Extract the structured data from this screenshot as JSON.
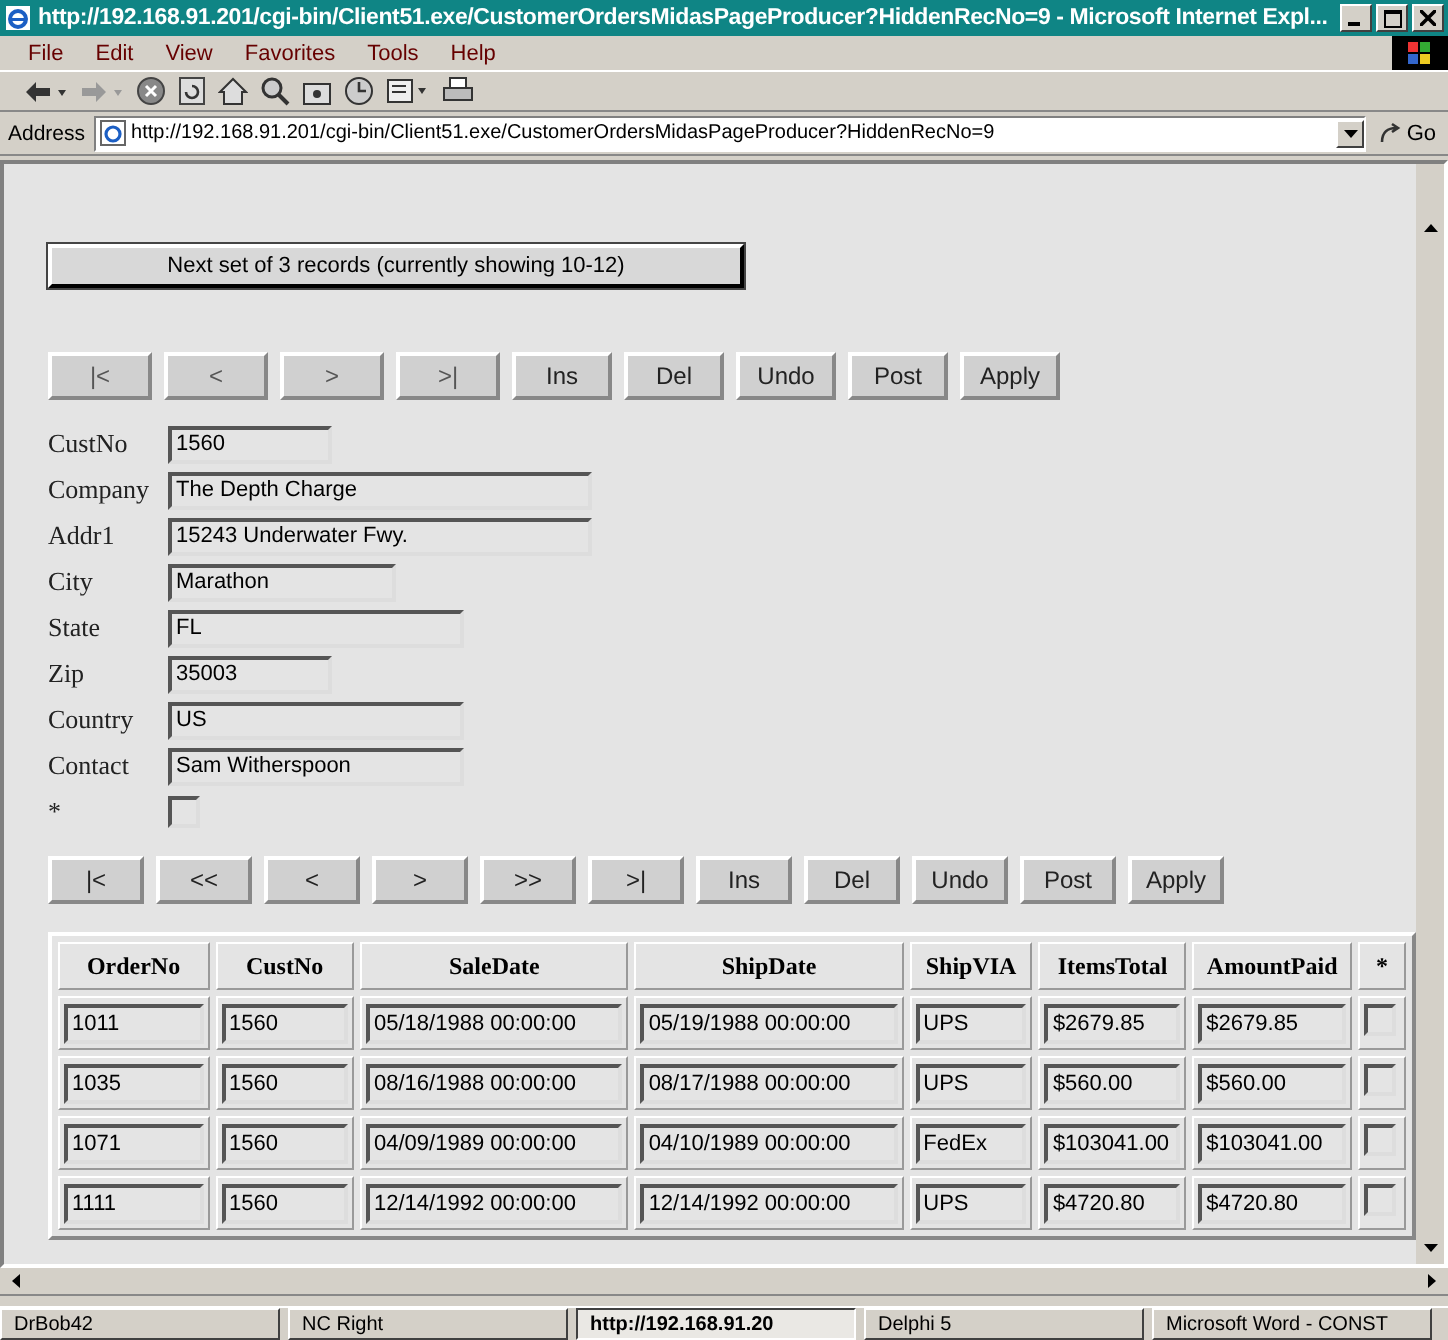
{
  "window": {
    "title": "http://192.168.91.201/cgi-bin/Client51.exe/CustomerOrdersMidasPageProducer?HiddenRecNo=9 - Microsoft Internet Expl..."
  },
  "menu": [
    "File",
    "Edit",
    "View",
    "Favorites",
    "Tools",
    "Help"
  ],
  "address": {
    "label": "Address",
    "value": "http://192.168.91.201/cgi-bin/Client51.exe/CustomerOrdersMidasPageProducer?HiddenRecNo=9",
    "go": "Go"
  },
  "next_button": "Next set of 3 records (currently showing 10-12)",
  "record_nav": [
    "|<",
    "<",
    ">",
    ">|",
    "Ins",
    "Del",
    "Undo",
    "Post",
    "Apply"
  ],
  "fields": [
    {
      "label": "CustNo",
      "value": "1560",
      "kind": "text"
    },
    {
      "label": "Company",
      "value": "The Depth Charge",
      "kind": "text"
    },
    {
      "label": "Addr1",
      "value": "15243 Underwater Fwy.",
      "kind": "text"
    },
    {
      "label": "City",
      "value": "Marathon",
      "kind": "text"
    },
    {
      "label": "State",
      "value": "FL",
      "kind": "text"
    },
    {
      "label": "Zip",
      "value": "35003",
      "kind": "text"
    },
    {
      "label": "Country",
      "value": "US",
      "kind": "text"
    },
    {
      "label": "Contact",
      "value": "Sam Witherspoon",
      "kind": "text"
    },
    {
      "label": "*",
      "kind": "checkbox",
      "checked": false
    }
  ],
  "grid_nav": [
    "|<",
    "<<",
    "<",
    ">",
    ">>",
    ">|",
    "Ins",
    "Del",
    "Undo",
    "Post",
    "Apply"
  ],
  "table": {
    "columns": [
      "OrderNo",
      "CustNo",
      "SaleDate",
      "ShipDate",
      "ShipVIA",
      "ItemsTotal",
      "AmountPaid",
      "*"
    ],
    "rows": [
      {
        "cells": [
          "1011",
          "1560",
          "05/18/1988 00:00:00",
          "05/19/1988 00:00:00",
          "UPS",
          "$2679.85",
          "$2679.85"
        ],
        "checked": false
      },
      {
        "cells": [
          "1035",
          "1560",
          "08/16/1988 00:00:00",
          "08/17/1988 00:00:00",
          "UPS",
          "$560.00",
          "$560.00"
        ],
        "checked": false
      },
      {
        "cells": [
          "1071",
          "1560",
          "04/09/1989 00:00:00",
          "04/10/1989 00:00:00",
          "FedEx",
          "$103041.00",
          "$103041.00"
        ],
        "checked": false
      },
      {
        "cells": [
          "1111",
          "1560",
          "12/14/1992 00:00:00",
          "12/14/1992 00:00:00",
          "UPS",
          "$4720.80",
          "$4720.80"
        ],
        "checked": false
      }
    ]
  },
  "taskbar": [
    {
      "label": "DrBob42",
      "selected": false
    },
    {
      "label": "NC Right",
      "selected": false
    },
    {
      "label": "http://192.168.91.20",
      "selected": true
    },
    {
      "label": "Delphi 5",
      "selected": false
    },
    {
      "label": "Microsoft Word - CONST",
      "selected": false
    }
  ]
}
